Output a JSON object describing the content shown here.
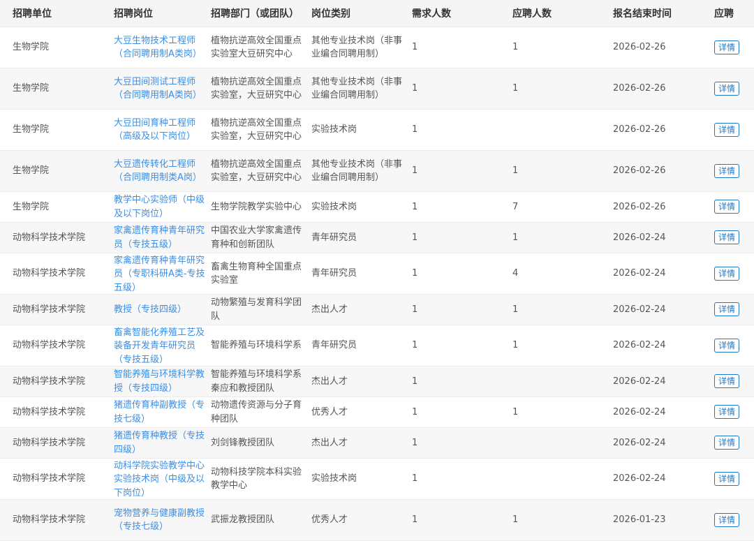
{
  "headers": {
    "unit": "招聘单位",
    "position": "招聘岗位",
    "department": "招聘部门（或团队）",
    "category": "岗位类别",
    "demand": "需求人数",
    "applicants": "应聘人数",
    "deadline": "报名结束时间",
    "apply": "应聘"
  },
  "details_label": "详情",
  "rows": [
    {
      "unit": "生物学院",
      "position": "大豆生物技术工程师（合同聘用制A类岗）",
      "department": "植物抗逆高效全国重点实验室大豆研究中心",
      "category": "其他专业技术岗（非事业编合同聘用制）",
      "demand": "1",
      "applicants": "1",
      "deadline": "2026-02-26"
    },
    {
      "unit": "生物学院",
      "position": "大豆田间测试工程师（合同聘用制A类岗）",
      "department": "植物抗逆高效全国重点实验室，大豆研究中心",
      "category": "其他专业技术岗（非事业编合同聘用制）",
      "demand": "1",
      "applicants": "1",
      "deadline": "2026-02-26"
    },
    {
      "unit": "生物学院",
      "position": "大豆田间育种工程师（高级及以下岗位）",
      "department": "植物抗逆高效全国重点实验室，大豆研究中心",
      "category": "实验技术岗",
      "demand": "1",
      "applicants": "",
      "deadline": "2026-02-26"
    },
    {
      "unit": "生物学院",
      "position": "大豆遗传转化工程师（合同聘用制类A岗）",
      "department": "植物抗逆高效全国重点实验室，大豆研究中心",
      "category": "其他专业技术岗（非事业编合同聘用制）",
      "demand": "1",
      "applicants": "1",
      "deadline": "2026-02-26"
    },
    {
      "unit": "生物学院",
      "position": "教学中心实验师（中级及以下岗位）",
      "department": "生物学院教学实验中心",
      "category": "实验技术岗",
      "demand": "1",
      "applicants": "7",
      "deadline": "2026-02-26"
    },
    {
      "unit": "动物科学技术学院",
      "position": "家禽遗传育种青年研究员（专技五级）",
      "department": "中国农业大学家禽遗传育种和创新团队",
      "category": "青年研究员",
      "demand": "1",
      "applicants": "1",
      "deadline": "2026-02-24"
    },
    {
      "unit": "动物科学技术学院",
      "position": "家禽遗传育种青年研究员（专职科研A类-专技五级）",
      "department": "畜禽生物育种全国重点实验室",
      "category": "青年研究员",
      "demand": "1",
      "applicants": "4",
      "deadline": "2026-02-24"
    },
    {
      "unit": "动物科学技术学院",
      "position": "教授（专技四级）",
      "department": "动物繁殖与发育科学团队",
      "category": "杰出人才",
      "demand": "1",
      "applicants": "1",
      "deadline": "2026-02-24"
    },
    {
      "unit": "动物科学技术学院",
      "position": "畜禽智能化养殖工艺及装备开发青年研究员（专技五级）",
      "department": "智能养殖与环境科学系",
      "category": "青年研究员",
      "demand": "1",
      "applicants": "1",
      "deadline": "2026-02-24"
    },
    {
      "unit": "动物科学技术学院",
      "position": "智能养殖与环境科学教授（专技四级）",
      "department": "智能养殖与环境科学系秦应和教授团队",
      "category": "杰出人才",
      "demand": "1",
      "applicants": "",
      "deadline": "2026-02-24"
    },
    {
      "unit": "动物科学技术学院",
      "position": "猪遗传育种副教授（专技七级）",
      "department": "动物遗传资源与分子育种团队",
      "category": "优秀人才",
      "demand": "1",
      "applicants": "1",
      "deadline": "2026-02-24"
    },
    {
      "unit": "动物科学技术学院",
      "position": "猪遗传育种教授（专技四级）",
      "department": "刘剑锋教授团队",
      "category": "杰出人才",
      "demand": "1",
      "applicants": "",
      "deadline": "2026-02-24"
    },
    {
      "unit": "动物科学技术学院",
      "position": "动科学院实验教学中心实验技术岗（中级及以下岗位）",
      "department": "动物科技学院本科实验教学中心",
      "category": "实验技术岗",
      "demand": "1",
      "applicants": "",
      "deadline": "2026-02-24"
    },
    {
      "unit": "动物科学技术学院",
      "position": "宠物营养与健康副教授（专技七级）",
      "department": "武振龙教授团队",
      "category": "优秀人才",
      "demand": "1",
      "applicants": "1",
      "deadline": "2026-01-23"
    }
  ]
}
